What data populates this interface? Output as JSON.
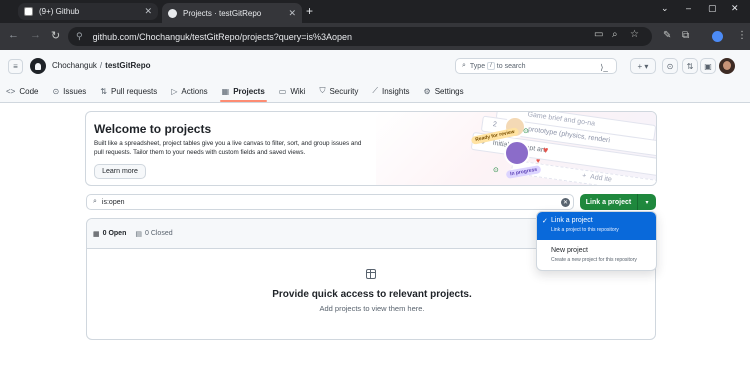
{
  "browser": {
    "tabs": [
      {
        "title": "(9+) Github",
        "active": false,
        "icon": "notion-icon"
      },
      {
        "title": "Projects · testGitRepo",
        "active": true,
        "icon": "github-icon"
      }
    ],
    "url": "github.com/Chochanguk/testGitRepo/projects?query=is%3Aopen",
    "new_tab_glyph": "+",
    "back_glyph": "←",
    "forward_glyph": "→",
    "reload_glyph": "↻",
    "window_controls": [
      "⌄",
      "–",
      "▢",
      "✕"
    ]
  },
  "github": {
    "owner": "Chochanguk",
    "separator": "/",
    "repo": "testGitRepo",
    "search": {
      "prefix": "Type",
      "key": "/",
      "suffix": "to search"
    },
    "nav": [
      {
        "label": "Code",
        "icon": "code-icon",
        "glyph": "<>"
      },
      {
        "label": "Issues",
        "icon": "issue-icon",
        "glyph": "⊙"
      },
      {
        "label": "Pull requests",
        "icon": "pull-request-icon",
        "glyph": "⇅"
      },
      {
        "label": "Actions",
        "icon": "play-icon",
        "glyph": "▷"
      },
      {
        "label": "Projects",
        "icon": "table-icon",
        "glyph": "▦"
      },
      {
        "label": "Wiki",
        "icon": "book-icon",
        "glyph": "▭"
      },
      {
        "label": "Security",
        "icon": "shield-icon",
        "glyph": "⛉"
      },
      {
        "label": "Insights",
        "icon": "graph-icon",
        "glyph": "⟋"
      },
      {
        "label": "Settings",
        "icon": "gear-icon",
        "glyph": "⚙"
      }
    ],
    "selected_nav": "Projects"
  },
  "welcome": {
    "title": "Welcome to projects",
    "description": "Built like a spreadsheet, project tables give you a live canvas to filter, sort, and group issues and pull requests. Tailor them to your needs with custom fields and saved views.",
    "learn_more": "Learn more",
    "illustration": {
      "ready_label": "Ready for review",
      "in_progress_label": "In progress",
      "rows": [
        "Game brief and go-na",
        "Engine prototype (physics, renderi",
        "Initial concept art",
        "Add ite"
      ],
      "row_numbers": [
        "2",
        "3"
      ],
      "plus": "+"
    }
  },
  "filter": {
    "value": "is:open",
    "clear_glyph": "✕"
  },
  "link_button": {
    "label": "Link a project",
    "caret": "▾"
  },
  "project_tabs": {
    "open_label": "0 Open",
    "closed_label": "0 Closed"
  },
  "empty_state": {
    "title": "Provide quick access to relevant projects.",
    "subtitle": "Add projects to view them here."
  },
  "menu": {
    "items": [
      {
        "label": "Link a project",
        "description": "Link a project to this repository",
        "selected": true,
        "check": "✓"
      },
      {
        "label": "New project",
        "description": "Create a new project for this repository",
        "selected": false
      }
    ]
  },
  "colors": {
    "primary_green": "#1f883d",
    "selected_blue": "#0969da",
    "nav_underline": "#fd8c73",
    "chrome_dark": "#202124"
  }
}
